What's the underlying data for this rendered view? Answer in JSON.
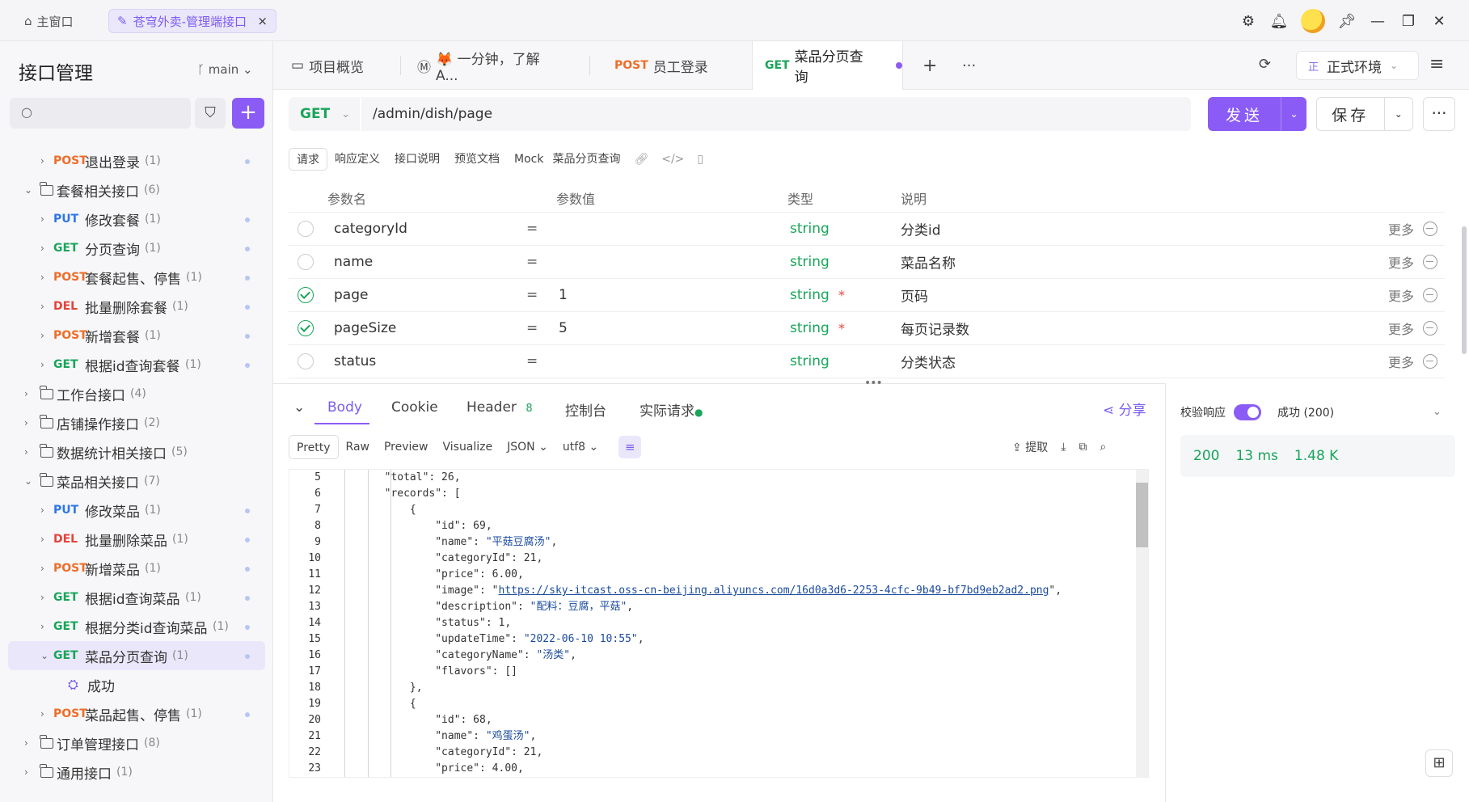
{
  "topbar": {
    "home_label": "主窗口",
    "app_tab_label": "苍穹外卖-管理端接口",
    "close_glyph": "×",
    "icons": [
      "gear-icon",
      "bell-icon",
      "avatar",
      "pin-icon",
      "minimize-icon",
      "restore-icon",
      "close-icon"
    ]
  },
  "sidebar": {
    "title": "接口管理",
    "branch": "main",
    "tree": [
      {
        "type": "api",
        "method": "POST",
        "label": "退出登录",
        "count": "(1)",
        "level": 1
      },
      {
        "type": "folder",
        "label": "套餐相关接口",
        "count": "(6)",
        "open": true
      },
      {
        "type": "api",
        "method": "PUT",
        "label": "修改套餐",
        "count": "(1)",
        "level": 1
      },
      {
        "type": "api",
        "method": "GET",
        "label": "分页查询",
        "count": "(1)",
        "level": 1
      },
      {
        "type": "api",
        "method": "POST",
        "label": "套餐起售、停售",
        "count": "(1)",
        "level": 1
      },
      {
        "type": "api",
        "method": "DEL",
        "label": "批量删除套餐",
        "count": "(1)",
        "level": 1
      },
      {
        "type": "api",
        "method": "POST",
        "label": "新增套餐",
        "count": "(1)",
        "level": 1
      },
      {
        "type": "api",
        "method": "GET",
        "label": "根据id查询套餐",
        "count": "(1)",
        "level": 1
      },
      {
        "type": "folder",
        "label": "工作台接口",
        "count": "(4)",
        "open": false
      },
      {
        "type": "folder",
        "label": "店铺操作接口",
        "count": "(2)",
        "open": false
      },
      {
        "type": "folder",
        "label": "数据统计相关接口",
        "count": "(5)",
        "open": false
      },
      {
        "type": "folder",
        "label": "菜品相关接口",
        "count": "(7)",
        "open": true
      },
      {
        "type": "api",
        "method": "PUT",
        "label": "修改菜品",
        "count": "(1)",
        "level": 1
      },
      {
        "type": "api",
        "method": "DEL",
        "label": "批量删除菜品",
        "count": "(1)",
        "level": 1
      },
      {
        "type": "api",
        "method": "POST",
        "label": "新增菜品",
        "count": "(1)",
        "level": 1
      },
      {
        "type": "api",
        "method": "GET",
        "label": "根据id查询菜品",
        "count": "(1)",
        "level": 1
      },
      {
        "type": "api",
        "method": "GET",
        "label": "根据分类id查询菜品",
        "count": "(1)",
        "level": 1
      },
      {
        "type": "api",
        "method": "GET",
        "label": "菜品分页查询",
        "count": "(1)",
        "level": 1,
        "selected": true,
        "open": true
      },
      {
        "type": "case",
        "label": "成功"
      },
      {
        "type": "api",
        "method": "POST",
        "label": "菜品起售、停售",
        "count": "(1)",
        "level": 1
      },
      {
        "type": "folder",
        "label": "订单管理接口",
        "count": "(8)",
        "open": false
      },
      {
        "type": "folder",
        "label": "通用接口",
        "count": "(1)",
        "open": false
      }
    ]
  },
  "tabs": [
    {
      "method": "",
      "label": "项目概览"
    },
    {
      "method": "",
      "label": "🦊 一分钟，了解 A..."
    },
    {
      "method": "POST",
      "label": "员工登录"
    },
    {
      "method": "GET",
      "label": "菜品分页查询",
      "active": true
    }
  ],
  "env": {
    "prefix": "正",
    "label": "正式环境"
  },
  "request": {
    "method": "GET",
    "url": "/admin/dish/page",
    "send_label": "发送",
    "save_label": "保存"
  },
  "subtabs": [
    "请求",
    "响应定义",
    "接口说明",
    "预览文档",
    "Mock",
    "菜品分页查询"
  ],
  "params": {
    "headers": [
      "参数名",
      "参数值",
      "类型",
      "说明"
    ],
    "rows": [
      {
        "checked": false,
        "name": "categoryId",
        "value": "",
        "type": "string",
        "required": false,
        "desc": "分类id"
      },
      {
        "checked": false,
        "name": "name",
        "value": "",
        "type": "string",
        "required": false,
        "desc": "菜品名称"
      },
      {
        "checked": true,
        "name": "page",
        "value": "1",
        "type": "string",
        "required": true,
        "desc": "页码"
      },
      {
        "checked": true,
        "name": "pageSize",
        "value": "5",
        "type": "string",
        "required": true,
        "desc": "每页记录数"
      },
      {
        "checked": false,
        "name": "status",
        "value": "",
        "type": "string",
        "required": false,
        "desc": "分类状态"
      }
    ],
    "more_label": "更多",
    "eq": "=",
    "req_mark": "*"
  },
  "response": {
    "tabs": [
      "Body",
      "Cookie",
      "Header",
      "控制台",
      "实际请求"
    ],
    "header_count": "8",
    "share_label": "分享",
    "formats": [
      "Pretty",
      "Raw",
      "Preview",
      "Visualize"
    ],
    "lang": "JSON",
    "encoding": "utf8",
    "extract_label": "提取",
    "code_lines": [
      {
        "n": "5",
        "t": "        \"total\": 26,"
      },
      {
        "n": "6",
        "t": "        \"records\": ["
      },
      {
        "n": "7",
        "t": "            {"
      },
      {
        "n": "8",
        "t": "                \"id\": 69,"
      },
      {
        "n": "9",
        "t": "                \"name\": \"平菇豆腐汤\","
      },
      {
        "n": "10",
        "t": "                \"categoryId\": 21,"
      },
      {
        "n": "11",
        "t": "                \"price\": 6.00,"
      },
      {
        "n": "12",
        "t": "                \"image\": \"https://sky-itcast.oss-cn-beijing.aliyuncs.com/16d0a3d6-2253-4cfc-9b49-bf7bd9eb2ad2.png\","
      },
      {
        "n": "13",
        "t": "                \"description\": \"配料：豆腐，平菇\","
      },
      {
        "n": "14",
        "t": "                \"status\": 1,"
      },
      {
        "n": "15",
        "t": "                \"updateTime\": \"2022-06-10 10:55\","
      },
      {
        "n": "16",
        "t": "                \"categoryName\": \"汤类\","
      },
      {
        "n": "17",
        "t": "                \"flavors\": []"
      },
      {
        "n": "18",
        "t": "            },"
      },
      {
        "n": "19",
        "t": "            {"
      },
      {
        "n": "20",
        "t": "                \"id\": 68,"
      },
      {
        "n": "21",
        "t": "                \"name\": \"鸡蛋汤\","
      },
      {
        "n": "22",
        "t": "                \"categoryId\": 21,"
      },
      {
        "n": "23",
        "t": "                \"price\": 4.00,"
      }
    ]
  },
  "status_panel": {
    "validate_label": "校验响应",
    "result_label": "成功 (200)",
    "code": "200",
    "time": "13 ms",
    "size": "1.48 K"
  }
}
